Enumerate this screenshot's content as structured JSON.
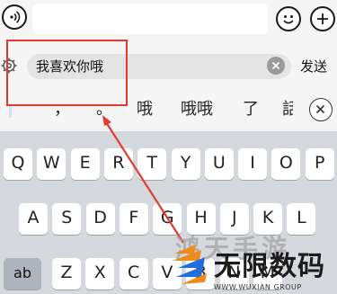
{
  "top_bar": {
    "voice_icon": "voice-icon",
    "emoji_icon": "emoji-icon",
    "plus_icon": "plus-icon"
  },
  "compose": {
    "text": "我喜欢你哦",
    "send_label": "发送",
    "gear_icon": "gear-icon",
    "clear_icon": "clear-icon"
  },
  "candidates": [
    "，",
    "。",
    "哦",
    "哦哦",
    "了",
    "話"
  ],
  "keyboard": {
    "row1": [
      "Q",
      "W",
      "E",
      "R",
      "T",
      "Y",
      "U",
      "I",
      "O",
      "P"
    ],
    "row2": [
      "A",
      "S",
      "D",
      "F",
      "G",
      "H",
      "J",
      "K",
      "L"
    ],
    "row3": [
      "Z",
      "X",
      "C",
      "V",
      "B",
      "N",
      "M"
    ],
    "mode_key": "ab"
  },
  "watermark": {
    "faded_text": "鸿天手游",
    "brand": "无限数码",
    "sub": "WWW.WUXIAN GROUP"
  },
  "colors": {
    "highlight_box": "#e23a30",
    "arrow": "#e23a30",
    "keyboard_bg": "#d5d8dd",
    "brand_orange": "#f08a1c",
    "brand_blue": "#1e6fd9"
  }
}
